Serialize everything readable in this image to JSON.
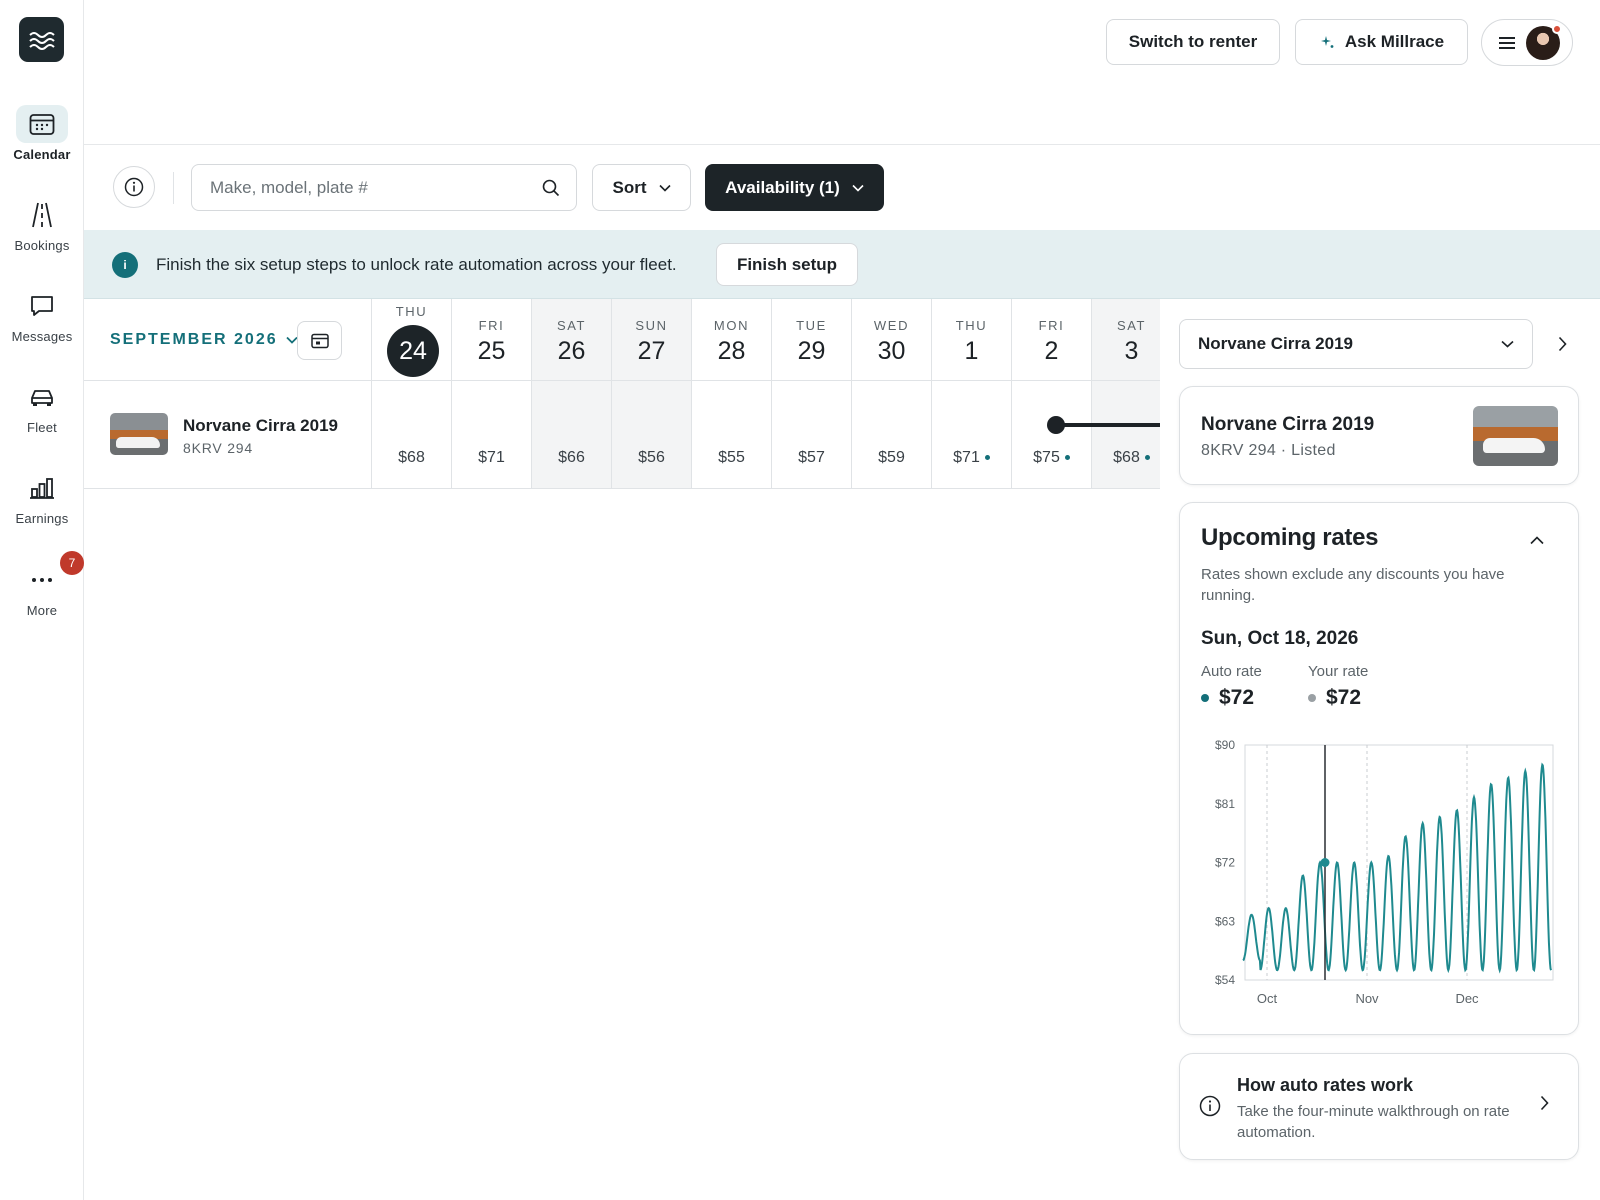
{
  "nav": {
    "logo": "millrace-logo",
    "items": [
      {
        "label": "Calendar",
        "icon": "calendar-icon",
        "active": true
      },
      {
        "label": "Bookings",
        "icon": "road-icon",
        "active": false
      },
      {
        "label": "Messages",
        "icon": "chat-bubble-icon",
        "active": false
      },
      {
        "label": "Fleet",
        "icon": "car-icon",
        "active": false
      },
      {
        "label": "Earnings",
        "icon": "bar-chart-icon",
        "active": false
      },
      {
        "label": "More",
        "icon": "ellipsis-icon",
        "active": false,
        "badge": "7"
      }
    ]
  },
  "topbar": {
    "switch_label": "Switch to renter",
    "ask_label": "Ask Millrace",
    "ask_icon": "sparkle-icon",
    "menu_icon": "hamburger-icon"
  },
  "toolbar": {
    "search_placeholder": "Make, model, plate #",
    "sort_label": "Sort",
    "availability_label": "Availability (1)"
  },
  "banner": {
    "icon_text": "i",
    "text": "Finish the six setup steps to unlock rate automation across your fleet.",
    "button": "Finish setup"
  },
  "calendar": {
    "month": "SEPTEMBER 2026",
    "days": [
      {
        "dow": "THU",
        "num": "24",
        "price": "$68",
        "today": true,
        "weekend": false,
        "dot": false
      },
      {
        "dow": "FRI",
        "num": "25",
        "price": "$71",
        "today": false,
        "weekend": false,
        "dot": false
      },
      {
        "dow": "SAT",
        "num": "26",
        "price": "$66",
        "today": false,
        "weekend": true,
        "dot": false
      },
      {
        "dow": "SUN",
        "num": "27",
        "price": "$56",
        "today": false,
        "weekend": true,
        "dot": false
      },
      {
        "dow": "MON",
        "num": "28",
        "price": "$55",
        "today": false,
        "weekend": false,
        "dot": false
      },
      {
        "dow": "TUE",
        "num": "29",
        "price": "$57",
        "today": false,
        "weekend": false,
        "dot": false
      },
      {
        "dow": "WED",
        "num": "30",
        "price": "$59",
        "today": false,
        "weekend": false,
        "dot": false
      },
      {
        "dow": "THU",
        "num": "1",
        "price": "$71",
        "today": false,
        "weekend": false,
        "dot": true
      },
      {
        "dow": "FRI",
        "num": "2",
        "price": "$75",
        "today": false,
        "weekend": false,
        "dot": true
      },
      {
        "dow": "SAT",
        "num": "3",
        "price": "$68",
        "today": false,
        "weekend": true,
        "dot": true
      }
    ],
    "vehicle": {
      "name": "Norvane Cirra 2019",
      "plate": "8KRV 294"
    }
  },
  "panel": {
    "selected_car": "Norvane Cirra 2019",
    "car_card": {
      "title": "Norvane Cirra 2019",
      "subtitle": "8KRV 294 · Listed"
    },
    "rates": {
      "title": "Upcoming rates",
      "note": "Rates shown exclude any discounts you have running.",
      "date": "Sun, Oct 18, 2026",
      "auto_label": "Auto rate",
      "auto_value": "$72",
      "your_label": "Your rate",
      "your_value": "$72",
      "auto_color": "#146f79",
      "your_color": "#9aa0a4"
    },
    "help": {
      "title": "How auto rates work",
      "subtitle": "Take the four-minute walkthrough on rate automation."
    }
  },
  "chart_data": {
    "type": "line",
    "ylim": [
      54,
      90
    ],
    "yticks": [
      "$90",
      "$81",
      "$72",
      "$63",
      "$54"
    ],
    "xticks": [
      "Oct",
      "Nov",
      "Dec"
    ],
    "grid": "vertical dashed at month starts",
    "selected": {
      "date": "Oct 18",
      "value": 72
    },
    "series": [
      {
        "color": "#1f8a8f",
        "peaks": [
          64,
          65,
          65,
          70,
          72,
          72,
          72,
          72,
          73,
          76,
          78,
          79,
          80,
          82,
          84,
          85,
          86,
          87
        ],
        "troughs": [
          57,
          55.5,
          55.5,
          55.5,
          55.5,
          55.5,
          55.5,
          55.5,
          55.5,
          55.5,
          55.5,
          55.5,
          55.5,
          55.5,
          55.5,
          55.5,
          55.5,
          55.5
        ]
      }
    ]
  }
}
